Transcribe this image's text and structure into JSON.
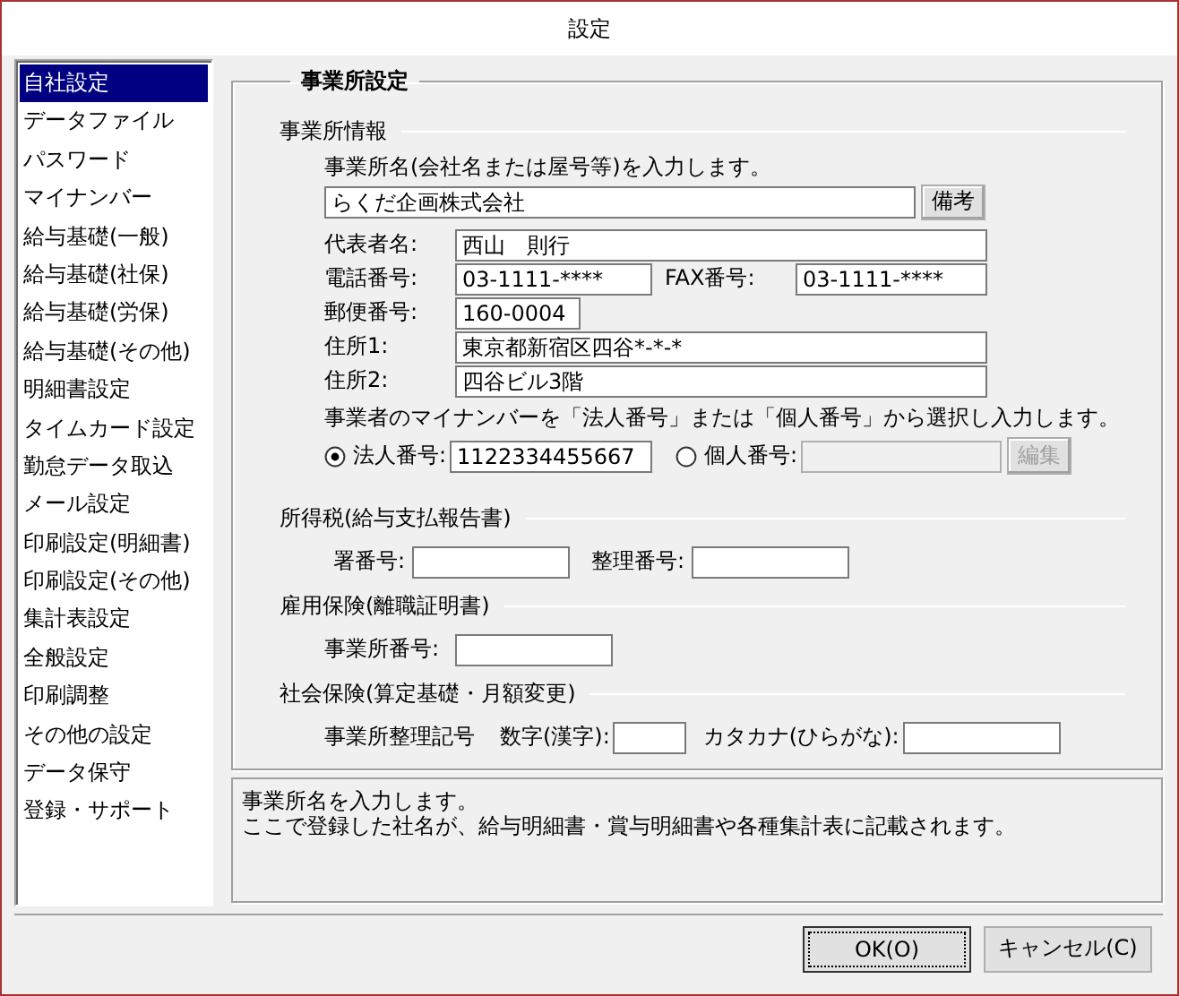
{
  "window": {
    "title": "設定"
  },
  "sidebar": {
    "items": [
      {
        "label": "自社設定",
        "selected": true
      },
      {
        "label": "データファイル",
        "selected": false
      },
      {
        "label": "パスワード",
        "selected": false
      },
      {
        "label": "マイナンバー",
        "selected": false
      },
      {
        "label": "給与基礎(一般)",
        "selected": false
      },
      {
        "label": "給与基礎(社保)",
        "selected": false
      },
      {
        "label": "給与基礎(労保)",
        "selected": false
      },
      {
        "label": "給与基礎(その他)",
        "selected": false
      },
      {
        "label": "明細書設定",
        "selected": false
      },
      {
        "label": "タイムカード設定",
        "selected": false
      },
      {
        "label": "勤怠データ取込",
        "selected": false
      },
      {
        "label": "メール設定",
        "selected": false
      },
      {
        "label": "印刷設定(明細書)",
        "selected": false
      },
      {
        "label": "印刷設定(その他)",
        "selected": false
      },
      {
        "label": "集計表設定",
        "selected": false
      },
      {
        "label": "全般設定",
        "selected": false
      },
      {
        "label": "印刷調整",
        "selected": false
      },
      {
        "label": "その他の設定",
        "selected": false
      },
      {
        "label": "データ保守",
        "selected": false
      },
      {
        "label": "登録・サポート",
        "selected": false
      }
    ]
  },
  "panel": {
    "title": "事業所設定"
  },
  "office_info": {
    "title": "事業所情報",
    "name_hint": "事業所名(会社名または屋号等)を入力します。",
    "name": {
      "value": "らくだ企画株式会社"
    },
    "memo_button": "備考",
    "representative": {
      "label": "代表者名:",
      "value": "西山　則行"
    },
    "phone": {
      "label": "電話番号:",
      "value": "03-1111-****"
    },
    "fax": {
      "label": "FAX番号:",
      "value": "03-1111-****"
    },
    "postal_code": {
      "label": "郵便番号:",
      "value": "160-0004"
    },
    "address1": {
      "label": "住所1:",
      "value": "東京都新宿区四谷*-*-*"
    },
    "address2": {
      "label": "住所2:",
      "value": "四谷ビル3階"
    },
    "mynumber_hint": "事業者のマイナンバーを「法人番号」または「個人番号」から選択し入力します。",
    "number_type": [
      {
        "label": "法人番号:",
        "selected": true,
        "value": "1122334455667"
      },
      {
        "label": "個人番号:",
        "selected": false
      }
    ],
    "edit_button": {
      "label": "編集",
      "disabled": true
    }
  },
  "income_tax": {
    "title": "所得税(給与支払報告書)",
    "fields": [
      {
        "label": "署番号:"
      },
      {
        "label": "整理番号:"
      }
    ]
  },
  "employment_insurance": {
    "title": "雇用保険(離職証明書)",
    "fields": [
      {
        "label": "事業所番号:"
      }
    ]
  },
  "social_insurance": {
    "title": "社会保険(算定基礎・月額変更)",
    "caption": "事業所整理記号",
    "fields": [
      {
        "label": "数字(漢字):"
      },
      {
        "label": "カタカナ(ひらがな):"
      }
    ]
  },
  "description": [
    "事業所名を入力します。",
    "ここで登録した社名が、給与明細書・賞与明細書や各種集計表に記載されます。"
  ],
  "buttons": [
    {
      "label": "OK(O)",
      "focused": true
    },
    {
      "label": "キャンセル(C)",
      "focused": false
    }
  ]
}
